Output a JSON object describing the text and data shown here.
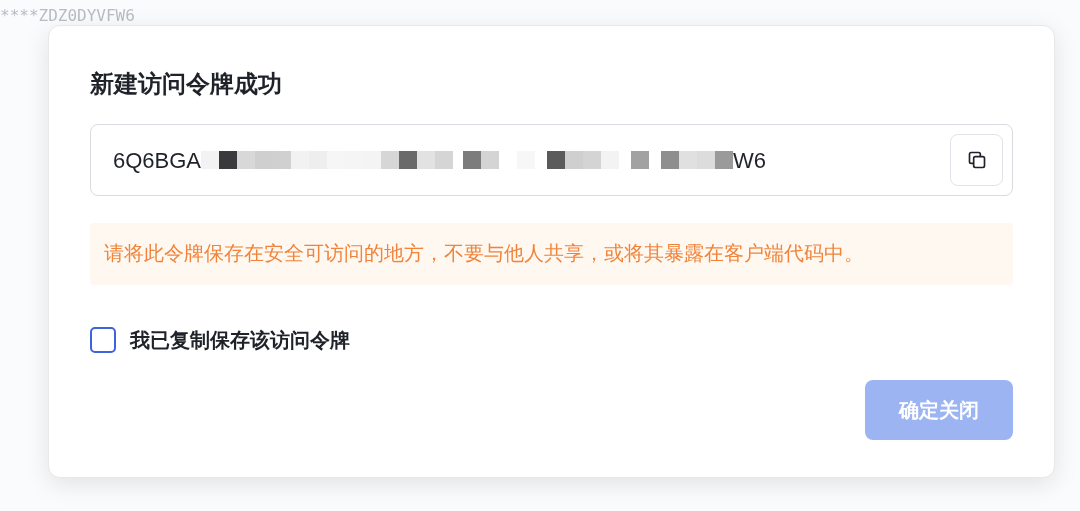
{
  "background": {
    "token_text": "****ZDZ0DYVFW6"
  },
  "dialog": {
    "title": "新建访问令牌成功",
    "token": {
      "start": "6Q6BGA",
      "end": "W6"
    },
    "warning": "请将此令牌保存在安全可访问的地方，不要与他人共享，或将其暴露在客户端代码中。",
    "confirm_checkbox": {
      "label": "我已复制保存该访问令牌",
      "checked": false
    },
    "close_button": {
      "label": "确定关闭",
      "disabled": true
    }
  }
}
